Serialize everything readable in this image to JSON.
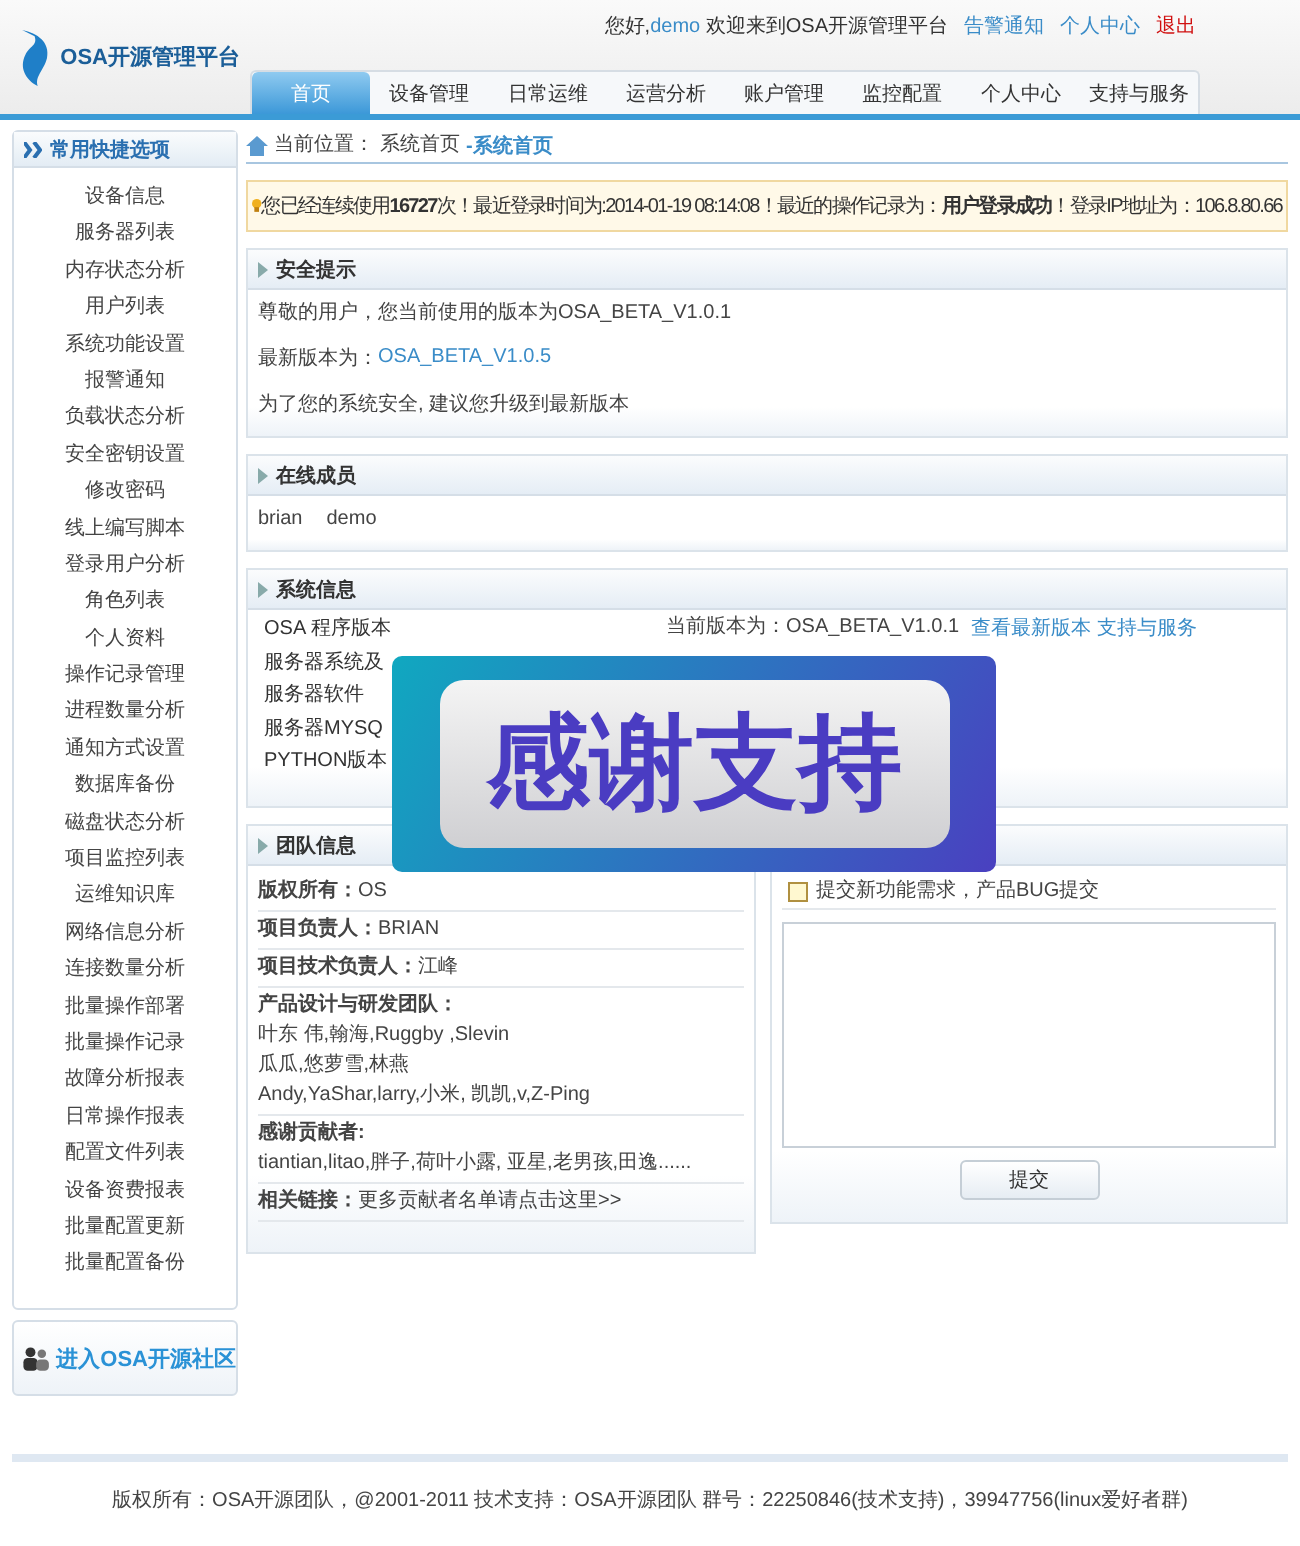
{
  "header": {
    "logo_text": "OSA开源管理平台",
    "greeting": "您好,",
    "user": "demo",
    "welcome": "欢迎来到OSA开源管理平台",
    "links": [
      {
        "label": "告警通知",
        "kind": "link"
      },
      {
        "label": "个人中心",
        "kind": "link"
      },
      {
        "label": "退出",
        "kind": "logout"
      }
    ]
  },
  "nav": [
    {
      "label": "首页",
      "selected": true
    },
    {
      "label": "设备管理",
      "selected": false
    },
    {
      "label": "日常运维",
      "selected": false
    },
    {
      "label": "运营分析",
      "selected": false
    },
    {
      "label": "账户管理",
      "selected": false
    },
    {
      "label": "监控配置",
      "selected": false
    },
    {
      "label": "个人中心",
      "selected": false
    },
    {
      "label": "支持与服务",
      "selected": false
    }
  ],
  "sidebar": {
    "title": "常用快捷选项",
    "items": [
      "设备信息",
      "服务器列表",
      "内存状态分析",
      "用户列表",
      "系统功能设置",
      "报警通知",
      "负载状态分析",
      "安全密钥设置",
      "修改密码",
      "线上编写脚本",
      "登录用户分析",
      "角色列表",
      "个人资料",
      "操作记录管理",
      "进程数量分析",
      "通知方式设置",
      "数据库备份",
      "磁盘状态分析",
      "项目监控列表",
      "运维知识库",
      "网络信息分析",
      "连接数量分析",
      "批量操作部署",
      "批量操作记录",
      "故障分析报表",
      "日常操作报表",
      "配置文件列表",
      "设备资费报表",
      "批量配置更新",
      "批量配置备份"
    ],
    "community_button": "进入OSA开源社区"
  },
  "breadcrumb": {
    "label": "当前位置：",
    "path": "系统首页",
    "current": "-系统首页"
  },
  "notice": "您已经连续使用**16727**次！最近登录时间为:2014-01-19 08:14:08！最近的操作记录为：**用户登录成功**！登录IP地址为：106.8.80.66",
  "security": {
    "title": "安全提示",
    "current": "尊敬的用户，您当前使用的版本为OSA_BETA_V1.0.1",
    "latest_label": "最新版本为：",
    "latest_link": "OSA_BETA_V1.0.5",
    "advice": "为了您的系统安全, 建议您升级到最新版本"
  },
  "online_members": {
    "title": "在线成员",
    "members": [
      "brian",
      "demo"
    ]
  },
  "system_info": {
    "title": "系统信息",
    "rows": [
      {
        "label": "OSA 程序版本",
        "value": "当前版本为：OSA_BETA_V1.0.1",
        "links": [
          "查看最新版本",
          "支持与服务"
        ]
      },
      {
        "label": "服务器系统及"
      },
      {
        "label": "服务器软件"
      },
      {
        "label": "服务器MYSQ"
      },
      {
        "label": "PYTHON版本"
      }
    ]
  },
  "team": {
    "title": "团队信息",
    "rows": [
      {
        "label": "版权所有：",
        "value": "OS"
      },
      {
        "label": "项目负责人：",
        "value": "BRIAN"
      },
      {
        "label": "项目技术负责人：",
        "value": "江峰"
      },
      {
        "label": "产品设计与研发团队：",
        "lines": [
          "叶东 伟,翰海,Ruggby ,Slevin",
          "瓜瓜,悠萝雪,林燕",
          "Andy,YaShar,larry,小米, 凯凯,v,Z-Ping"
        ]
      },
      {
        "label": "感谢贡献者:",
        "lines": [
          "tiantian,litao,胖子,荷叶小露, 亚星,老男孩,田逸......"
        ]
      },
      {
        "label": "相关链接：",
        "value": "更多贡献者名单请点击这里>>"
      }
    ]
  },
  "feedback": {
    "hint": "提交新功能需求，产品BUG提交",
    "submit": "提交"
  },
  "overlay": {
    "text": "感谢支持"
  },
  "footer": "版权所有：OSA开源团队，@2001-2011 技术支持：OSA开源团队 群号：22250846(技术支持)，39947756(linux爱好者群)"
}
